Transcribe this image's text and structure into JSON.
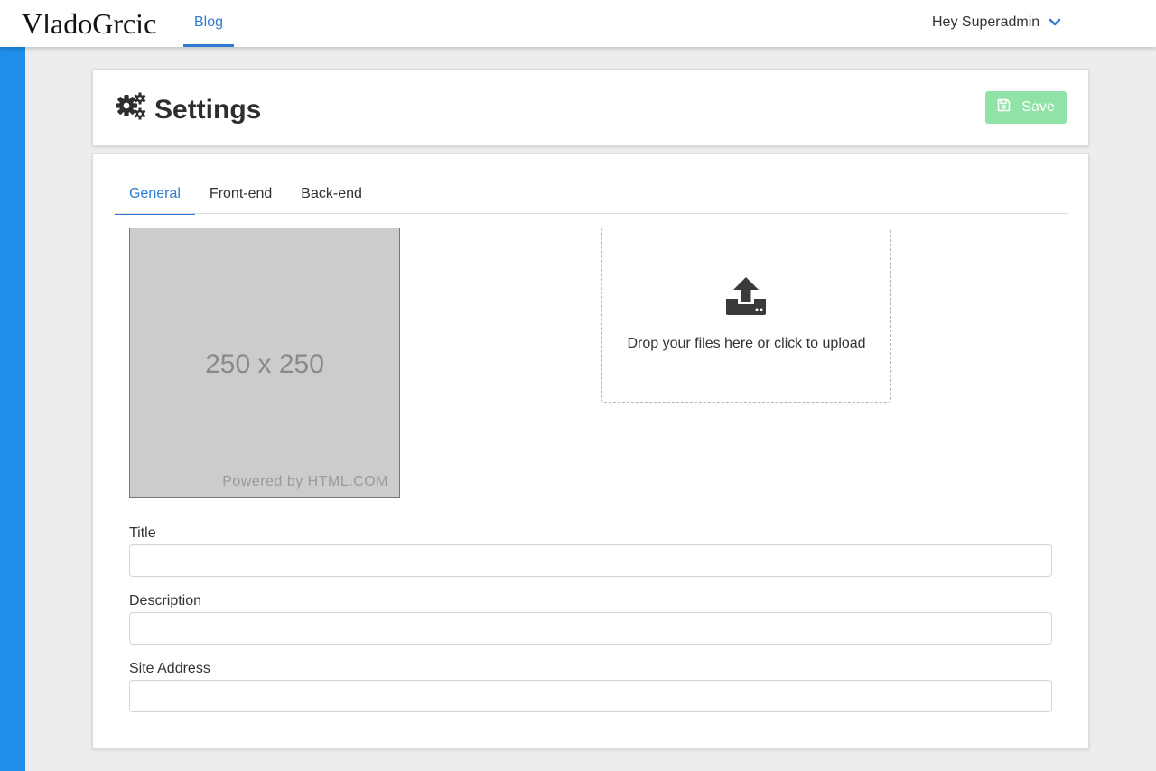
{
  "navbar": {
    "brand": "VladoGrcic",
    "links": [
      {
        "label": "Blog",
        "active": true
      }
    ],
    "user_greeting": "Hey Superadmin",
    "accent_color": "#2f7bd3"
  },
  "sidebar": {
    "color": "#1e8ee8"
  },
  "header": {
    "title": "Settings",
    "title_icon": "cogs-icon",
    "save_label": "Save",
    "save_icon": "floppy-disk-icon",
    "save_color": "#8fe3a6"
  },
  "tabs": [
    {
      "label": "General",
      "active": true
    },
    {
      "label": "Front-end",
      "active": false
    },
    {
      "label": "Back-end",
      "active": false
    }
  ],
  "image_placeholder": {
    "size_text": "250 x 250",
    "powered_text": "Powered by HTML.COM"
  },
  "dropzone": {
    "icon": "upload-icon",
    "text": "Drop your files here or click to upload"
  },
  "form": {
    "title": {
      "label": "Title",
      "value": ""
    },
    "description": {
      "label": "Description",
      "value": ""
    },
    "site_address": {
      "label": "Site Address",
      "value": ""
    }
  }
}
